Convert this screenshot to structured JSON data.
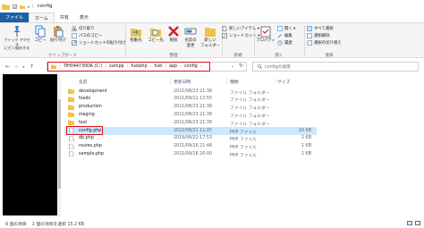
{
  "window": {
    "title": "config"
  },
  "tabs": [
    {
      "label": "ファイル"
    },
    {
      "label": "ホーム"
    },
    {
      "label": "共有"
    },
    {
      "label": "表示"
    }
  ],
  "ribbon": {
    "pin_label": "クイック アクセス\nにピン留めする",
    "copy_label": "コピー",
    "paste_label": "貼り付け",
    "cut_label": "切り取り",
    "copy_path_label": "パスのコピー",
    "paste_shortcut_label": "ショートカットの貼り付け",
    "clipboard_group": "クリップボード",
    "move_label": "移動先",
    "copyto_label": "コピー先",
    "delete_label": "削除",
    "rename_label": "名前の\n変更",
    "new_folder_label": "新しい\nフォルダー",
    "organize_group": "整理",
    "new_item_label": "新しいアイテム ▾",
    "shortcut_label": "ショートカット ▾",
    "new_group": "新規",
    "properties_label": "プロパティ",
    "open_label": "開く ▾",
    "edit_label": "編集",
    "history_label": "履歴",
    "open_group": "開く",
    "select_all_label": "すべて選択",
    "select_none_label": "選択解除",
    "invert_label": "選択の切り替え",
    "select_group": "選択"
  },
  "address": {
    "crumbs": [
      "TIH044730DA (C:)",
      "xampp",
      "fuelphp",
      "fuel",
      "app",
      "config"
    ],
    "search_placeholder": "configの検索"
  },
  "columns": {
    "name": "名前",
    "date": "更新日時",
    "type": "種類",
    "size": "サイズ"
  },
  "files": [
    {
      "name": "development",
      "date": "2021/08/23 21:38",
      "type": "ファイル フォルダー",
      "size": "",
      "kind": "folder"
    },
    {
      "name": "foods",
      "date": "2021/09/12 13:55",
      "type": "ファイル フォルダー",
      "size": "",
      "kind": "folder"
    },
    {
      "name": "production",
      "date": "2021/08/23 21:38",
      "type": "ファイル フォルダー",
      "size": "",
      "kind": "folder"
    },
    {
      "name": "staging",
      "date": "2021/08/23 21:38",
      "type": "ファイル フォルダー",
      "size": "",
      "kind": "folder"
    },
    {
      "name": "test",
      "date": "2021/08/23 21:38",
      "type": "ファイル フォルダー",
      "size": "",
      "kind": "folder"
    },
    {
      "name": "config.php",
      "date": "2022/08/21 11:05",
      "type": "PHP ファイル",
      "size": "16 KB",
      "kind": "php"
    },
    {
      "name": "db.php",
      "date": "2019/06/22 17:53",
      "type": "PHP ファイル",
      "size": "2 KB",
      "kind": "php"
    },
    {
      "name": "routes.php",
      "date": "2021/09/16 21:46",
      "type": "PHP ファイル",
      "size": "1 KB",
      "kind": "php"
    },
    {
      "name": "sample.php",
      "date": "2021/09/16 20:00",
      "type": "PHP ファイル",
      "size": "1 KB",
      "kind": "php"
    }
  ],
  "status": {
    "item_count": "9 個の項目",
    "selected": "1 個の項目を選択  15.2 KB"
  }
}
